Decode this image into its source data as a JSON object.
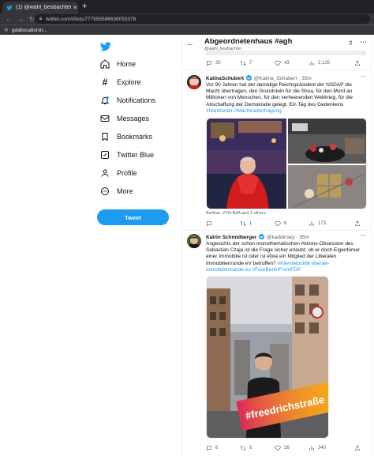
{
  "browser": {
    "tab_title": "(1) @wahl_beobachter/li",
    "tab_close": "×",
    "new_tab": "+",
    "url": "twitter.com/i/lists/777955586638053378",
    "bookmark_label": "gdallocationin..."
  },
  "sidebar": {
    "items": [
      {
        "label": "Home",
        "icon": "home-icon"
      },
      {
        "label": "Explore",
        "icon": "hashtag-icon"
      },
      {
        "label": "Notifications",
        "icon": "bell-icon"
      },
      {
        "label": "Messages",
        "icon": "envelope-icon"
      },
      {
        "label": "Bookmarks",
        "icon": "bookmark-icon"
      },
      {
        "label": "Twitter Blue",
        "icon": "twitter-blue-icon"
      },
      {
        "label": "Profile",
        "icon": "person-icon"
      },
      {
        "label": "More",
        "icon": "more-circle-icon"
      }
    ],
    "tweet_button": "Tweet"
  },
  "header": {
    "title": "Abgeordnetenhaus #agh",
    "subtitle": "@wahl_beobachter"
  },
  "top_actions": {
    "replies": "30",
    "retweets": "7",
    "likes": "43",
    "views": "2,125"
  },
  "tweets": [
    {
      "name": "KatinaSchubert",
      "handle": "@Katina_Schubert · 35m",
      "text_plain": "Vor 90 Jahren hat der damalige Reichspräsident der NSDAP die Macht übertragen, den Grundstein für die Shoa, für den Mord an Millionen von Menschen, für den verheerenden Weltkrieg, für die Abschaffung der Demokratie gelegt. Ein Tag des Gedenkens ",
      "hashtag1": "#NieWieder",
      "hashtag2": "#Machtuebertragung",
      "caption": "Berliner VVN-BdA and 2 others",
      "replies": "",
      "retweets": "1",
      "likes": "6",
      "views": "173"
    },
    {
      "name": "Katrin Schmidberger",
      "handle": "@kaddinsky · 35m",
      "text_plain": "Angesichts der schon monothematischen Aktions-Obsession des Sebastian Czaja ist die Frage sicher erlaubt, ob er doch Eigentümer einer Immobilie ist oder ist etwa ein Mitglied der Liberalen Immobilienrunde eV betroffen? ",
      "hashtag1": "#Klientelpolitik",
      "link": "liberale-immobilienrunde.eu",
      "hashtag2": "#FreeBerlinFromFDP",
      "banner_text": "#freedrichstraße",
      "replies": "6",
      "retweets": "6",
      "likes": "26",
      "views": "340"
    }
  ],
  "colors": {
    "accent": "#1d9bf0",
    "text": "#0f1419",
    "secondary": "#536471"
  }
}
